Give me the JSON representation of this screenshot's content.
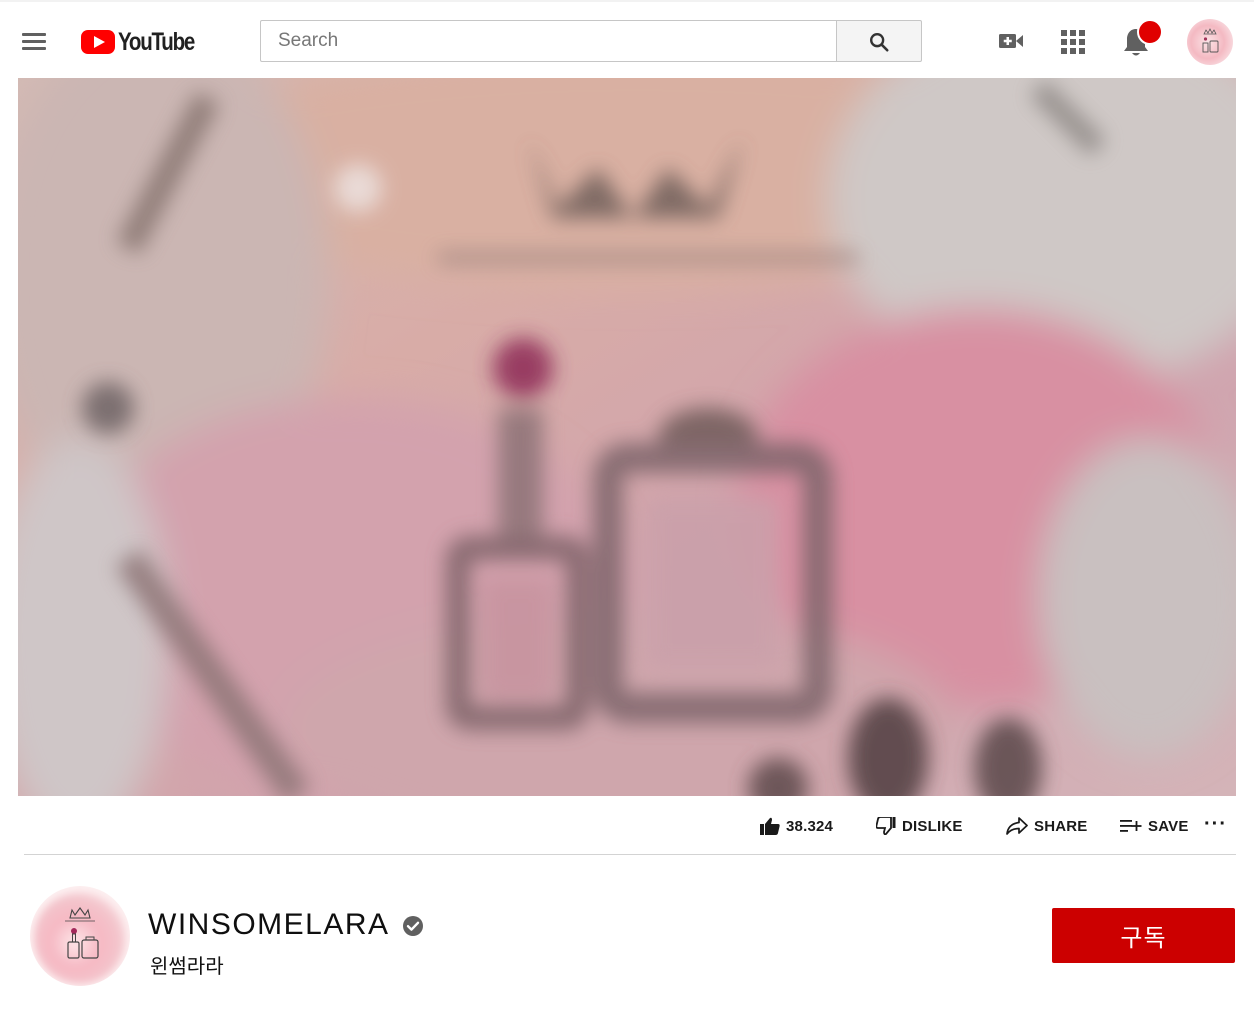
{
  "header": {
    "logo_text": "YouTube",
    "search_placeholder": "Search",
    "icons": [
      "menu-icon",
      "youtube-logo-icon",
      "search-icon",
      "create-video-icon",
      "apps-grid-icon",
      "notifications-bell-icon",
      "account-avatar"
    ]
  },
  "actions": {
    "like_count": "38.324",
    "dislike_label": "DISLIKE",
    "share_label": "SHARE",
    "save_label": "SAVE",
    "more_label": "···"
  },
  "channel": {
    "name": "WINSOMELARA",
    "subtitle": "윈썸라라",
    "subscribe_label": "구독"
  },
  "colors": {
    "brand_red": "#ff0000",
    "subscribe_red": "#cc0000",
    "notification_dot": "#e00000"
  }
}
